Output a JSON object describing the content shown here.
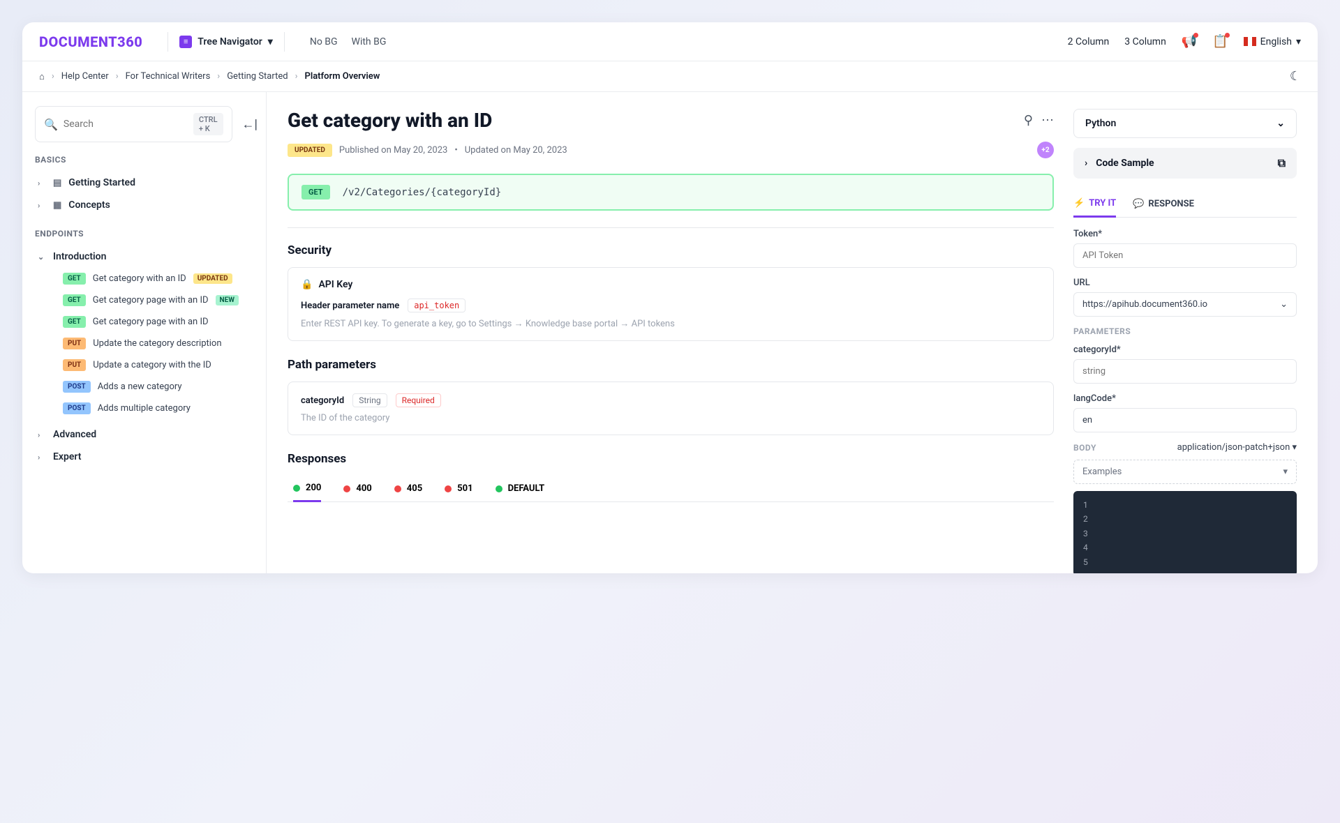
{
  "header": {
    "logo": "DOCUMENT360",
    "tree_nav": "Tree Navigator",
    "links": [
      "No BG",
      "With BG"
    ],
    "right_links": [
      "2 Column",
      "3 Column"
    ],
    "language": "English"
  },
  "breadcrumb": [
    "Help Center",
    "For Technical Writers",
    "Getting Started",
    "Platform Overview"
  ],
  "sidebar": {
    "search_placeholder": "Search",
    "search_kbd": "CTRL + K",
    "sections": {
      "basics": "BASICS",
      "endpoints": "ENDPOINTS"
    },
    "basics_items": [
      {
        "label": "Getting Started",
        "icon": "▤"
      },
      {
        "label": "Concepts",
        "icon": "▦"
      }
    ],
    "intro": "Introduction",
    "endpoints": [
      {
        "method": "GET",
        "label": "Get category with an ID",
        "badge": "UPDATED"
      },
      {
        "method": "GET",
        "label": "Get category page with an ID",
        "badge": "NEW"
      },
      {
        "method": "GET",
        "label": "Get category page with an ID"
      },
      {
        "method": "PUT",
        "label": "Update the category description"
      },
      {
        "method": "PUT",
        "label": "Update a category with the ID"
      },
      {
        "method": "POST",
        "label": "Adds a new category"
      },
      {
        "method": "POST",
        "label": "Adds multiple category"
      }
    ],
    "bottom_items": [
      "Advanced",
      "Expert"
    ]
  },
  "content": {
    "title": "Get category with an ID",
    "updated_badge": "UPDATED",
    "published": "Published on May 20, 2023",
    "updated": "Updated on May 20, 2023",
    "avatars": "+2",
    "method": "GET",
    "path": "/v2/Categories/{categoryId}",
    "security": {
      "heading": "Security",
      "title": "API Key",
      "param_label": "Header parameter name",
      "param_name": "api_token",
      "desc": "Enter REST API key. To generate a key, go to Settings → Knowledge base portal → API tokens"
    },
    "path_params": {
      "heading": "Path parameters",
      "name": "categoryId",
      "type": "String",
      "required": "Required",
      "desc": "The ID of the category"
    },
    "responses": {
      "heading": "Responses",
      "items": [
        {
          "code": "200",
          "color": "#22c55e"
        },
        {
          "code": "400",
          "color": "#ef4444"
        },
        {
          "code": "405",
          "color": "#ef4444"
        },
        {
          "code": "501",
          "color": "#ef4444"
        },
        {
          "code": "DEFAULT",
          "color": "#22c55e"
        }
      ]
    }
  },
  "panel": {
    "language": "Python",
    "code_sample": "Code Sample",
    "tabs": {
      "try": "TRY IT",
      "response": "RESPONSE"
    },
    "token_label": "Token*",
    "token_placeholder": "API Token",
    "url_label": "URL",
    "url_value": "https://apihub.document360.io",
    "params_label": "PARAMETERS",
    "categoryId_label": "categoryId*",
    "categoryId_placeholder": "string",
    "langCode_label": "langCode*",
    "langCode_value": "en",
    "body_label": "BODY",
    "content_type": "application/json-patch+json",
    "examples": "Examples",
    "code_lines": [
      "1",
      "2",
      "3",
      "4",
      "5"
    ]
  }
}
